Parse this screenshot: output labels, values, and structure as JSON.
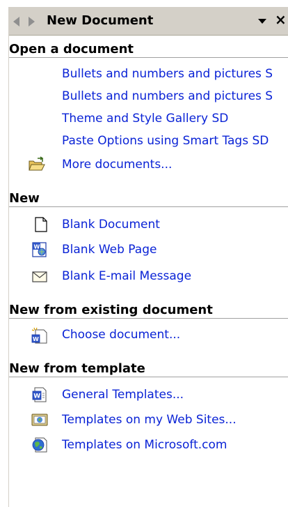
{
  "titlebar": {
    "title": "New Document",
    "back_icon": "back-arrow-icon",
    "forward_icon": "forward-arrow-icon",
    "menu_icon": "dropdown-arrow-icon",
    "close_label": "×"
  },
  "open_section": {
    "heading": "Open a document",
    "items": [
      {
        "label": "Bullets and numbers and pictures S"
      },
      {
        "label": "Bullets and numbers and pictures S"
      },
      {
        "label": "Theme and Style Gallery SD"
      },
      {
        "label": "Paste Options using Smart Tags SD"
      }
    ],
    "more": {
      "label": "More documents...",
      "icon": "open-folder-icon"
    }
  },
  "new_section": {
    "heading": "New",
    "items": [
      {
        "label": "Blank Document",
        "icon": "blank-page-icon"
      },
      {
        "label": "Blank Web Page",
        "icon": "web-page-icon"
      },
      {
        "label": "Blank E-mail Message",
        "icon": "envelope-icon"
      }
    ]
  },
  "existing_section": {
    "heading": "New from existing document",
    "items": [
      {
        "label": "Choose document...",
        "icon": "new-from-existing-icon"
      }
    ]
  },
  "template_section": {
    "heading": "New from template",
    "items": [
      {
        "label": "General Templates...",
        "icon": "word-template-icon"
      },
      {
        "label": "Templates on my Web Sites...",
        "icon": "web-sites-template-icon"
      },
      {
        "label": "Templates on Microsoft.com",
        "icon": "globe-icon"
      }
    ]
  },
  "colors": {
    "link": "#0a23d6",
    "titlebar_bg": "#d4d0c8"
  }
}
